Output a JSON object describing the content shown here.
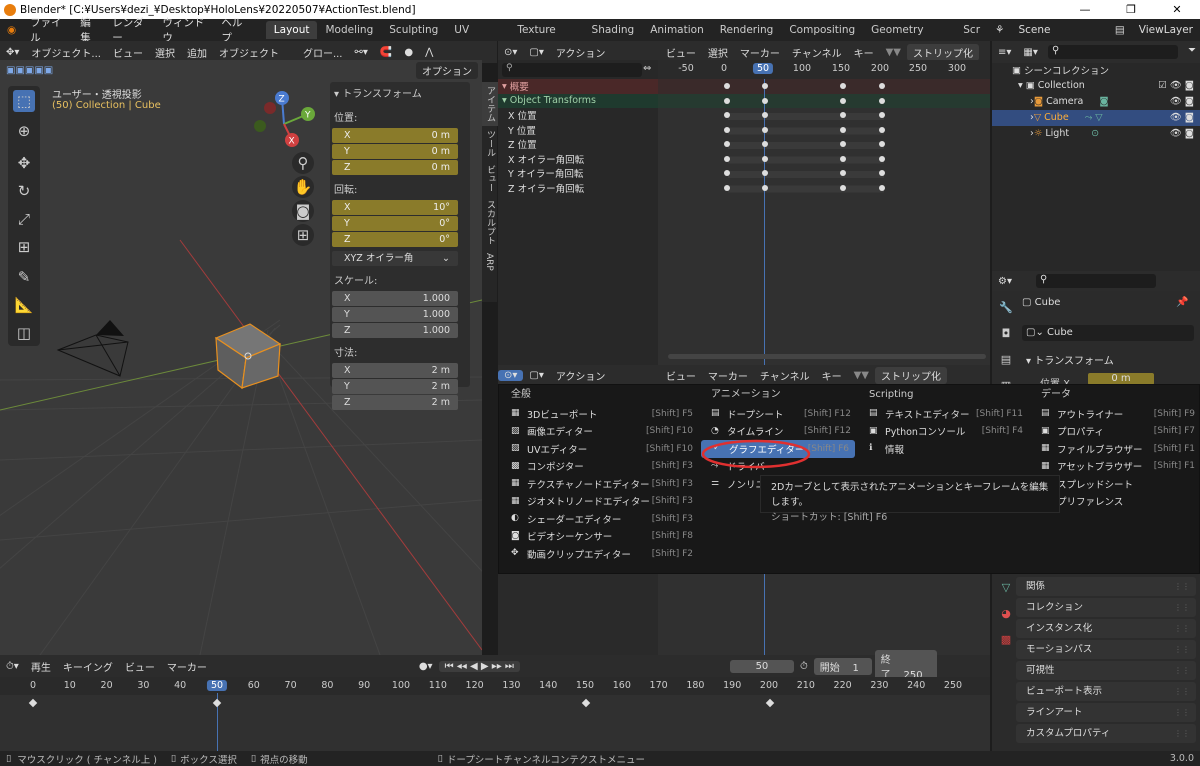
{
  "title": "Blender* [C:¥Users¥dezi_¥Desktop¥HoloLens¥20220507¥ActionTest.blend]",
  "menus": [
    "ファイル",
    "編集",
    "レンダー",
    "ウィンドウ",
    "ヘルプ"
  ],
  "workspaces": [
    "Layout",
    "Modeling",
    "Sculpting",
    "UV Editing",
    "Texture Paint",
    "Shading",
    "Animation",
    "Rendering",
    "Compositing",
    "Geometry Nodes",
    "Scr"
  ],
  "scene": "Scene",
  "viewlayer": "ViewLayer",
  "viewport": {
    "mode": "オブジェクト...",
    "view": "ビュー",
    "select": "選択",
    "add": "追加",
    "object": "オブジェクト",
    "global": "グロー...",
    "options": "オプション",
    "info1": "ユーザー・透視投影",
    "info2": "(50) Collection | Cube"
  },
  "npanel": {
    "title": "トランスフォーム",
    "location": "位置:",
    "rotation": "回転:",
    "mode": "XYZ オイラー角",
    "scale": "スケール:",
    "dims": "寸法:",
    "loc": [
      [
        "X",
        "0 m"
      ],
      [
        "Y",
        "0 m"
      ],
      [
        "Z",
        "0 m"
      ]
    ],
    "rot": [
      [
        "X",
        "10°"
      ],
      [
        "Y",
        "0°"
      ],
      [
        "Z",
        "0°"
      ]
    ],
    "scl": [
      [
        "X",
        "1.000"
      ],
      [
        "Y",
        "1.000"
      ],
      [
        "Z",
        "1.000"
      ]
    ],
    "dim": [
      [
        "X",
        "2 m"
      ],
      [
        "Y",
        "2 m"
      ],
      [
        "Z",
        "2 m"
      ]
    ]
  },
  "sidetabs": [
    "アイテム",
    "ツール",
    "ビュー",
    "スカルプト",
    "ARP"
  ],
  "dope": {
    "mode": "アクション",
    "view": "ビュー",
    "select": "選択",
    "marker": "マーカー",
    "channel": "チャンネル",
    "key": "キー",
    "strip": "ストリップ化",
    "ticks": [
      "-50",
      "0",
      "50",
      "100",
      "150",
      "200",
      "250",
      "300"
    ],
    "rows": [
      "概要",
      "Object Transforms",
      "X 位置",
      "Y 位置",
      "Z 位置",
      "X オイラー角回転",
      "Y オイラー角回転",
      "Z オイラー角回転"
    ]
  },
  "outliner": {
    "title": "シーンコレクション",
    "items": [
      "Collection",
      "Camera",
      "Cube",
      "Light"
    ]
  },
  "props": {
    "obj": "Cube",
    "data": "Cube",
    "section": "トランスフォーム",
    "loc_label": "位置 X",
    "loc_val": "0 m",
    "cats": [
      "関係",
      "コレクション",
      "インスタンス化",
      "モーションパス",
      "可視性",
      "ビューポート表示",
      "ラインアート",
      "カスタムプロパティ"
    ]
  },
  "menu": {
    "cols": [
      {
        "head": "全般",
        "items": [
          [
            "3Dビューポート",
            "[Shift] F5"
          ],
          [
            "画像エディター",
            "[Shift] F10"
          ],
          [
            "UVエディター",
            "[Shift] F10"
          ],
          [
            "コンポジター",
            "[Shift] F3"
          ],
          [
            "テクスチャノードエディター",
            "[Shift] F3"
          ],
          [
            "ジオメトリノードエディター",
            "[Shift] F3"
          ],
          [
            "シェーダーエディター",
            "[Shift] F3"
          ],
          [
            "ビデオシーケンサー",
            "[Shift] F8"
          ],
          [
            "動画クリップエディター",
            "[Shift] F2"
          ]
        ]
      },
      {
        "head": "アニメーション",
        "items": [
          [
            "ドープシート",
            "[Shift] F12"
          ],
          [
            "タイムライン",
            "[Shift] F12"
          ],
          [
            "グラフエディター",
            "[Shift] F6"
          ],
          [
            "ドライバー",
            ""
          ],
          [
            "ノンリニア",
            ""
          ]
        ]
      },
      {
        "head": "Scripting",
        "items": [
          [
            "テキストエディター",
            "[Shift] F11"
          ],
          [
            "Pythonコンソール",
            "[Shift] F4"
          ],
          [
            "情報",
            ""
          ]
        ]
      },
      {
        "head": "データ",
        "items": [
          [
            "アウトライナー",
            "[Shift] F9"
          ],
          [
            "プロパティ",
            "[Shift] F7"
          ],
          [
            "ファイルブラウザー",
            "[Shift] F1"
          ],
          [
            "アセットブラウザー",
            "[Shift] F1"
          ],
          [
            "スプレッドシート",
            ""
          ],
          [
            "プリファレンス",
            ""
          ]
        ]
      }
    ]
  },
  "tooltip": {
    "line1": "2Dカーブとして表示されたアニメーションとキーフレームを編集します。",
    "line2": "ショートカット: [Shift] F6"
  },
  "timeline": {
    "play": "再生",
    "keying": "キーイング",
    "view": "ビュー",
    "marker": "マーカー",
    "frame": "50",
    "start_label": "開始",
    "start": "1",
    "end_label": "終了",
    "end": "250",
    "ticks": [
      "0",
      "10",
      "20",
      "30",
      "40",
      "50",
      "60",
      "70",
      "80",
      "90",
      "100",
      "110",
      "120",
      "130",
      "140",
      "150",
      "160",
      "170",
      "180",
      "190",
      "200",
      "210",
      "220",
      "230",
      "240",
      "250"
    ]
  },
  "status": {
    "s1": "マウスクリック ( チャンネル上 )",
    "s2": "ボックス選択",
    "s3": "視点の移動",
    "s4": "ドープシートチャンネルコンテクストメニュー",
    "version": "3.0.0"
  },
  "colors": {
    "accent": "#4772b3",
    "orange": "#e87d0d",
    "highlight": "#e03030"
  }
}
